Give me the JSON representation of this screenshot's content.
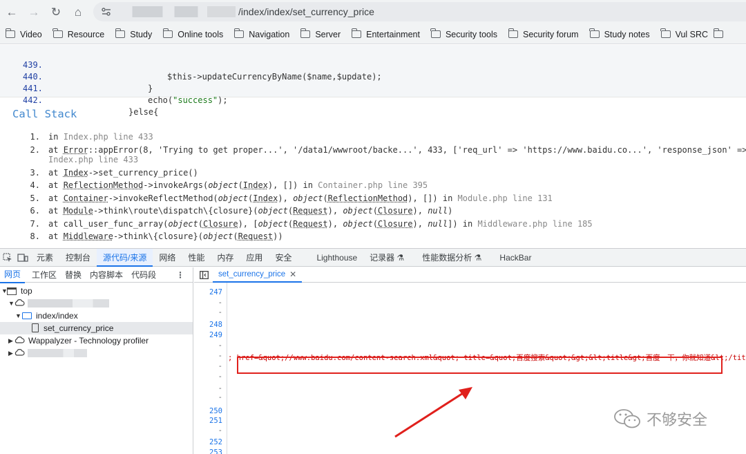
{
  "browser": {
    "url_suffix": "/index/index/set_currency_price",
    "bookmarks": [
      "Video",
      "Resource",
      "Study",
      "Online tools",
      "Navigation",
      "Server",
      "Entertainment",
      "Security tools",
      "Security forum",
      "Study notes",
      "Vul SRC"
    ]
  },
  "code": {
    "lines": [
      {
        "num": "439.",
        "text": "$this->updateCurrencyByName($name,$update);"
      },
      {
        "num": "440.",
        "text": "}"
      },
      {
        "num": "441.",
        "pre": "echo(",
        "str": "\"success\"",
        "post": ");"
      },
      {
        "num": "442.",
        "text": "}else{"
      }
    ]
  },
  "call_stack": {
    "title": "Call Stack",
    "items": [
      {
        "num": "1."
      },
      {
        "num": "2.",
        "wrap": "Index.php line 433"
      },
      {
        "num": "3."
      },
      {
        "num": "4."
      },
      {
        "num": "5."
      },
      {
        "num": "6."
      },
      {
        "num": "7."
      },
      {
        "num": "8."
      }
    ]
  },
  "devtools": {
    "tabs": [
      "元素",
      "控制台",
      "源代码/来源",
      "网络",
      "性能",
      "内存",
      "应用",
      "安全",
      "Lighthouse",
      "记录器",
      "性能数据分析",
      "HackBar"
    ],
    "active_tab": "源代码/来源",
    "nav_subtabs": [
      "网页",
      "工作区",
      "替换",
      "内容脚本",
      "代码段"
    ],
    "tree": {
      "top": "top",
      "folder": "index/index",
      "file": "set_currency_price",
      "ext": "Wappalyzer - Technology profiler"
    },
    "editor_tab": "set_currency_price",
    "gutter": [
      "247",
      "-",
      "-",
      "248",
      "249",
      "-",
      "-",
      "-",
      "-",
      "-",
      "-",
      "250",
      "251",
      "-",
      "252",
      "253"
    ],
    "xml_snippet": "; href=&quot;//www.baidu.com/content-search.xml&quot; title=&quot;百度搜索&quot;&gt;&lt;title&gt;百度一下，你就知道&lt;/title"
  },
  "watermark": "不够安全",
  "colors": {
    "link": "#4288ce",
    "accent": "#1a73e8",
    "highlight": "#e0201c"
  }
}
